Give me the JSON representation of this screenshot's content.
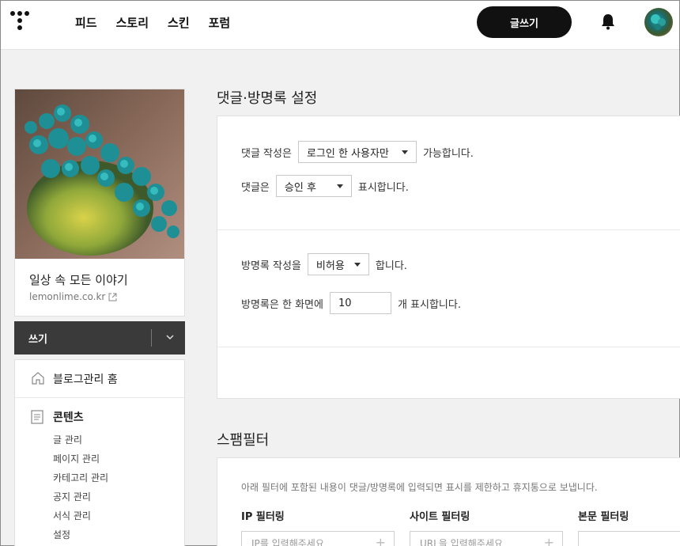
{
  "topbar": {
    "nav": [
      "피드",
      "스토리",
      "스킨",
      "포럼"
    ],
    "write_button": "글쓰기"
  },
  "blog": {
    "title": "일상 속 모든 이야기",
    "url": "lemonlime.co.kr"
  },
  "write_bar": {
    "label": "쓰기"
  },
  "menu": {
    "home": "블로그관리 홈",
    "contents": {
      "head": "콘텐츠",
      "items": [
        "글 관리",
        "페이지 관리",
        "카테고리 관리",
        "공지 관리",
        "서식 관리",
        "설정"
      ]
    }
  },
  "comments": {
    "section_title": "댓글·방명록 설정",
    "row1": {
      "prefix": "댓글 작성은",
      "select": "로그인 한 사용자만",
      "suffix": "가능합니다."
    },
    "row2": {
      "prefix": "댓글은",
      "select": "승인 후",
      "suffix": "표시합니다."
    },
    "row3": {
      "prefix": "방명록 작성을",
      "select": "비허용",
      "suffix": "합니다."
    },
    "row4": {
      "prefix": "방명록은 한 화면에",
      "value": "10",
      "suffix": "개 표시합니다."
    }
  },
  "spam": {
    "section_title": "스팸필터",
    "description": "아래 필터에 포함된 내용이 댓글/방명록에 입력되면 표시를 제한하고 휴지통으로 보냅니다.",
    "ip": {
      "head": "IP 필터링",
      "placeholder": "IP를 입력해주세요"
    },
    "site": {
      "head": "사이트 필터링",
      "placeholder": "URL을 입력해주세요"
    },
    "body": {
      "head": "본문 필터링",
      "placeholder": ""
    }
  }
}
